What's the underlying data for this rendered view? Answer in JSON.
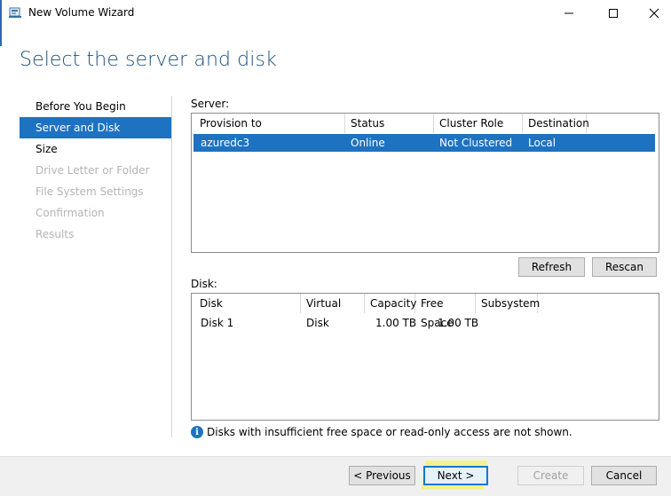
{
  "window": {
    "title": "New Volume Wizard",
    "minimize_glyph": "—",
    "maximize_glyph": "□",
    "close_glyph": "✕"
  },
  "heading": "Select the server and disk",
  "nav": {
    "items": [
      {
        "label": "Before You Begin",
        "state": "normal"
      },
      {
        "label": "Server and Disk",
        "state": "active"
      },
      {
        "label": "Size",
        "state": "normal"
      },
      {
        "label": "Drive Letter or Folder",
        "state": "disabled"
      },
      {
        "label": "File System Settings",
        "state": "disabled"
      },
      {
        "label": "Confirmation",
        "state": "disabled"
      },
      {
        "label": "Results",
        "state": "disabled"
      }
    ]
  },
  "server": {
    "label": "Server:",
    "columns": [
      "Provision to",
      "Status",
      "Cluster Role",
      "Destination"
    ],
    "rows": [
      {
        "provision_to": "azuredc3",
        "status": "Online",
        "cluster_role": "Not Clustered",
        "destination": "Local",
        "selected": true
      }
    ],
    "refresh_label": "Refresh",
    "rescan_label": "Rescan"
  },
  "disk": {
    "label": "Disk:",
    "columns": [
      "Disk",
      "Virtual Disk",
      "Capacity",
      "Free Space",
      "Subsystem"
    ],
    "rows": [
      {
        "disk": "Disk 1",
        "virtual_disk": "",
        "capacity": "1.00 TB",
        "free_space": "1.00 TB",
        "subsystem": ""
      }
    ]
  },
  "info": {
    "icon": "info-icon",
    "text": "Disks with insufficient free space or read-only access are not shown."
  },
  "footer": {
    "previous_label": "< Previous",
    "next_label": "Next >",
    "create_label": "Create",
    "cancel_label": "Cancel"
  },
  "colors": {
    "accent": "#1e72c2",
    "heading": "#1e4e79",
    "highlight": "#f3f56a"
  }
}
